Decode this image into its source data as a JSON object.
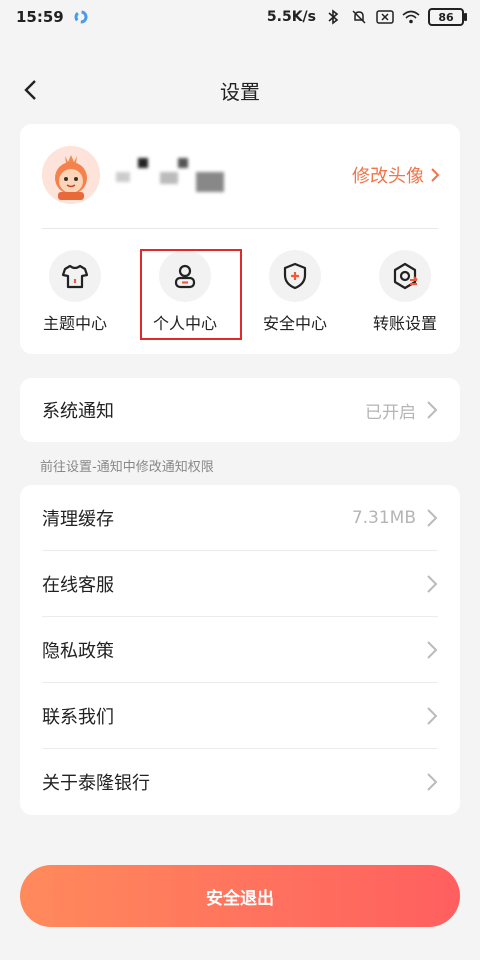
{
  "status_bar": {
    "time": "15:59",
    "network_speed": "5.5K/s",
    "battery": "86"
  },
  "nav": {
    "title": "设置"
  },
  "profile": {
    "edit_avatar_label": "修改头像"
  },
  "quick_actions": [
    {
      "label": "主题中心",
      "icon": "tshirt-icon"
    },
    {
      "label": "个人中心",
      "icon": "person-icon"
    },
    {
      "label": "安全中心",
      "icon": "shield-icon"
    },
    {
      "label": "转账设置",
      "icon": "transfer-settings-icon"
    }
  ],
  "notification": {
    "label": "系统通知",
    "value": "已开启",
    "hint": "前往设置-通知中修改通知权限"
  },
  "settings_list": [
    {
      "label": "清理缓存",
      "value": "7.31MB"
    },
    {
      "label": "在线客服",
      "value": ""
    },
    {
      "label": "隐私政策",
      "value": ""
    },
    {
      "label": "联系我们",
      "value": ""
    },
    {
      "label": "关于泰隆银行",
      "value": ""
    }
  ],
  "logout_label": "安全退出",
  "colors": {
    "accent": "#f2734a",
    "highlight_border": "#e02a2a",
    "logout_gradient_start": "#ff8a5c",
    "logout_gradient_end": "#ff5f5f"
  }
}
